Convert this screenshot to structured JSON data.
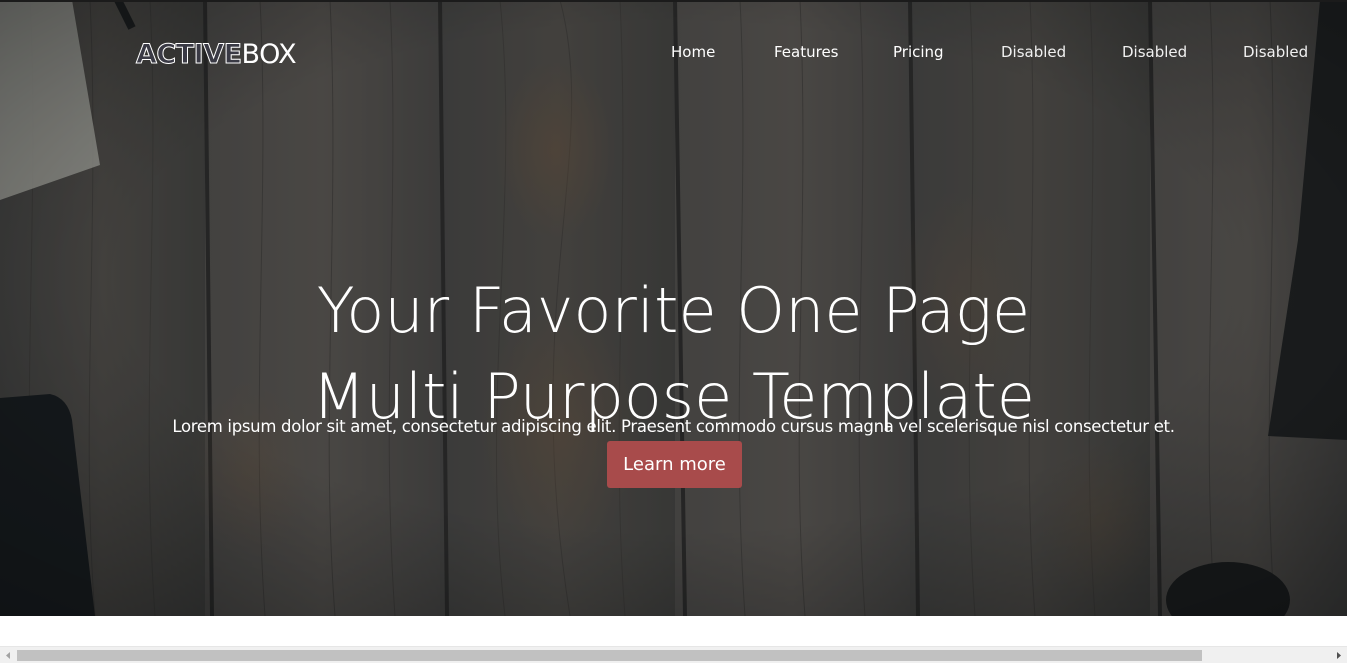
{
  "header": {
    "logo": {
      "part1": "ACTIVE",
      "part2": "BOX"
    },
    "nav": [
      {
        "label": "Home",
        "state": "active"
      },
      {
        "label": "Features",
        "state": "normal"
      },
      {
        "label": "Pricing",
        "state": "normal"
      },
      {
        "label": "Disabled",
        "state": "disabled"
      },
      {
        "label": "Disabled",
        "state": "disabled"
      },
      {
        "label": "Disabled",
        "state": "disabled"
      }
    ]
  },
  "hero": {
    "title_line1": "Your Favorite One Page",
    "title_line2": "Multi Purpose Template",
    "subtitle": "Lorem ipsum dolor sit amet, consectetur adipiscing elit. Praesent commodo cursus magna vel scelerisque nisl consectetur et.",
    "cta_label": "Learn more"
  },
  "colors": {
    "cta_background": "#a84b4b",
    "hero_overlay": "#1c2326",
    "text": "#ffffff"
  },
  "scrollbar": {
    "orientation": "horizontal",
    "left_arrow_icon": "chevron-left-icon",
    "right_arrow_icon": "chevron-right-icon"
  }
}
